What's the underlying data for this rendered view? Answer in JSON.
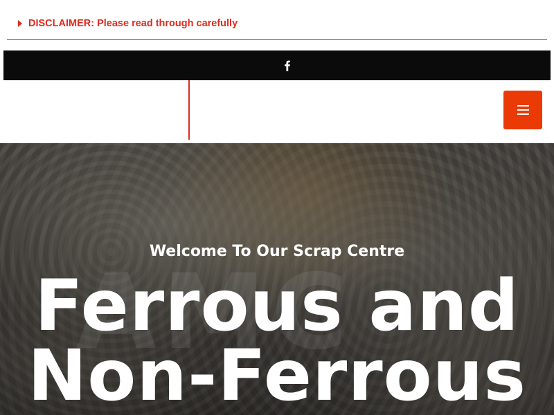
{
  "disclaimer": {
    "label": "DISCLAIMER: Please read through carefully",
    "icon": "caret-right-icon"
  },
  "social": {
    "icons": [
      "facebook-icon"
    ]
  },
  "header": {
    "menu_icon": "hamburger-menu-icon"
  },
  "hero": {
    "watermark": "AMC",
    "kicker": "Welcome To Our Scrap Centre",
    "title_line1": "Ferrous and",
    "title_line2": "Non-Ferrous"
  },
  "colors": {
    "accent": "#e02b20",
    "menu_button": "#ea3a06",
    "social_bar": "#0b0b0b"
  }
}
